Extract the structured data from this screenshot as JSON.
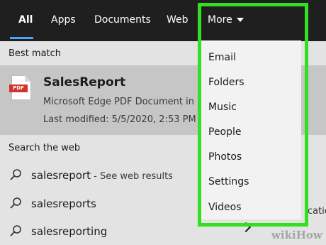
{
  "tabs": [
    {
      "label": "All",
      "active": true
    },
    {
      "label": "Apps"
    },
    {
      "label": "Documents"
    },
    {
      "label": "Web"
    },
    {
      "label": "More"
    }
  ],
  "best_match": {
    "heading": "Best match",
    "title": "SalesReport",
    "subtitle": "Microsoft Edge PDF Document in D",
    "modified": "Last modified: 5/5/2020, 2:53 PM",
    "icon": "pdf-file-icon",
    "icon_text": "PDF"
  },
  "web": {
    "heading": "Search the web",
    "results": [
      {
        "query": "salesreport",
        "suffix": " - See web results"
      },
      {
        "query": "salesreports",
        "suffix": ""
      },
      {
        "query": "salesreporting",
        "suffix": ""
      }
    ],
    "peek_text": "cation"
  },
  "more_menu": {
    "items": [
      "Email",
      "Folders",
      "Music",
      "People",
      "Photos",
      "Settings",
      "Videos"
    ]
  },
  "watermark": "wikiHow",
  "colors": {
    "highlight": "#33e01f",
    "accent": "#4aa3ff",
    "pdf_red": "#d2332b"
  }
}
